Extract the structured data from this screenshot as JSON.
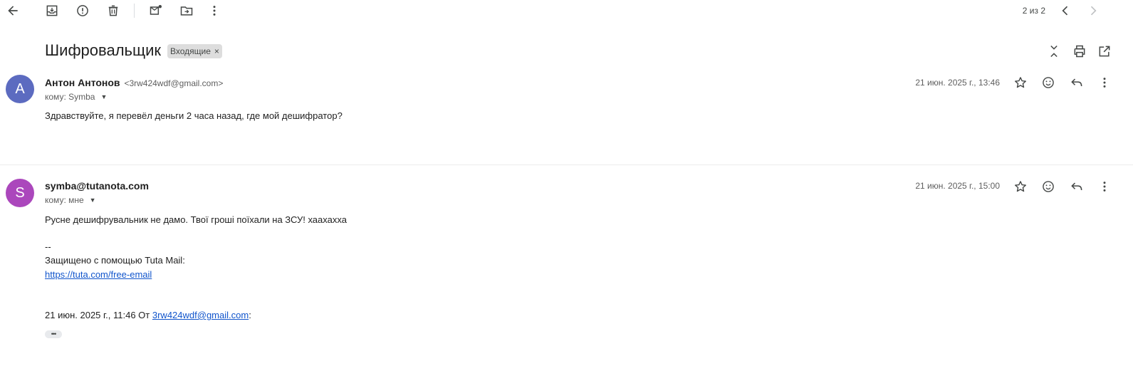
{
  "toolbar": {
    "icons": [
      "back-arrow-icon",
      "archive-icon",
      "report-spam-icon",
      "delete-icon",
      "mark-unread-icon",
      "move-to-icon",
      "more-vert-icon"
    ],
    "pager_text": "2 из 2"
  },
  "thread": {
    "subject": "Шифровальщик",
    "label": "Входящие",
    "label_remove": "×"
  },
  "messages": [
    {
      "avatar_letter": "A",
      "avatar_color": "#5c6bc0",
      "sender_name": "Антон Антонов",
      "sender_email": "<3rw424wdf@gmail.com>",
      "to": "кому: Symba",
      "date": "21 июн. 2025 г., 13:46",
      "body": "Здравствуйте, я перевёл деньги 2 часа назад, где мой дешифратор?"
    },
    {
      "avatar_letter": "S",
      "avatar_color": "#ab47bc",
      "sender_name": "symba@tutanota.com",
      "to": "кому: мне",
      "date": "21 июн. 2025 г., 15:00",
      "body": "Русне дешифрувальник не дамо. Твої гроші поїхали на ЗСУ! хаахахха",
      "signature_dash": "--",
      "signature_text": "Защищено с помощью Tuta Mail:",
      "signature_link": "https://tuta.com/free-email",
      "quote_prefix": "21 июн. 2025 г., 11:46 От ",
      "quote_email": "3rw424wdf@gmail.com",
      "quote_suffix": ":",
      "show_trimmed": "•••"
    }
  ]
}
